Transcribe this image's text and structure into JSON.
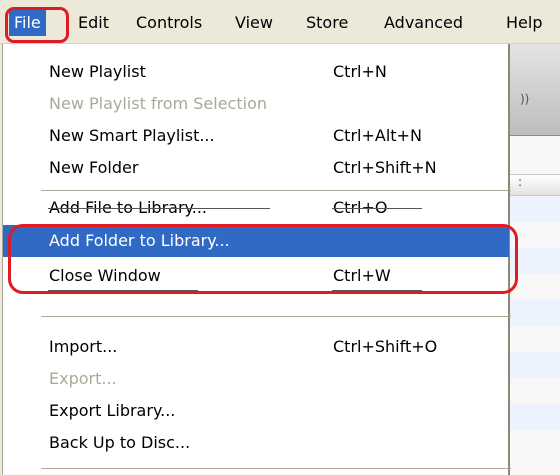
{
  "menubar": {
    "items": [
      {
        "label": "File",
        "active": true
      },
      {
        "label": "Edit"
      },
      {
        "label": "Controls"
      },
      {
        "label": "View"
      },
      {
        "label": "Store"
      },
      {
        "label": "Advanced"
      },
      {
        "label": "Help"
      }
    ]
  },
  "menu": {
    "items": [
      {
        "label": "New Playlist",
        "shortcut": "Ctrl+N",
        "state": "enabled"
      },
      {
        "label": "New Playlist from Selection",
        "shortcut": "",
        "state": "disabled"
      },
      {
        "label": "New Smart Playlist...",
        "shortcut": "Ctrl+Alt+N",
        "state": "enabled"
      },
      {
        "label": "New Folder",
        "shortcut": "Ctrl+Shift+N",
        "state": "enabled"
      },
      {
        "label": "Add File to Library...",
        "shortcut": "Ctrl+O",
        "state": "enabled"
      },
      {
        "label": "Add Folder to Library...",
        "shortcut": "",
        "state": "highlighted"
      },
      {
        "label": "Close Window",
        "shortcut": "Ctrl+W",
        "state": "enabled"
      },
      {
        "label": "Import...",
        "shortcut": "Ctrl+Shift+O",
        "state": "enabled"
      },
      {
        "label": "Export...",
        "shortcut": "",
        "state": "disabled"
      },
      {
        "label": "Export Library...",
        "shortcut": "",
        "state": "enabled"
      },
      {
        "label": "Back Up to Disc...",
        "shortcut": "",
        "state": "enabled"
      }
    ]
  },
  "colors": {
    "highlight": "#316ac5",
    "annotation": "#e01b24",
    "disabled_text": "#aca899"
  },
  "icons": {
    "volume": "speaker-icon"
  }
}
